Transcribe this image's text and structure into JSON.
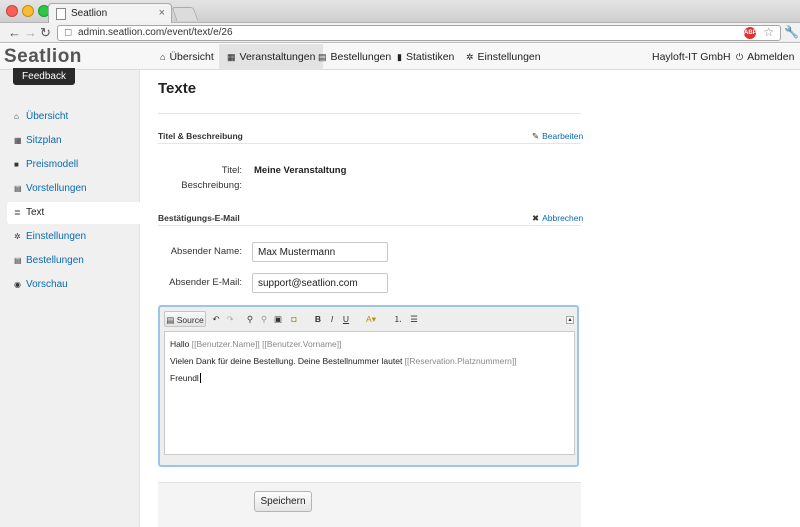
{
  "browser": {
    "tab_title": "Seatlion",
    "url": "admin.seatlion.com/event/text/e/26",
    "back_icon": "back-arrow-icon",
    "forward_icon": "forward-arrow-icon",
    "reload_icon": "reload-icon",
    "adblock_label": "ABP"
  },
  "app": {
    "logo_a": "Seat",
    "logo_b": "lion",
    "feedback_label": "Feedback",
    "nav": [
      {
        "label": "Übersicht",
        "icon": "home-icon"
      },
      {
        "label": "Veranstaltungen",
        "icon": "grid-icon"
      },
      {
        "label": "Bestellungen",
        "icon": "table-icon"
      },
      {
        "label": "Statistiken",
        "icon": "bar-chart-icon"
      },
      {
        "label": "Einstellungen",
        "icon": "gear-icon"
      }
    ],
    "company": "Hayloft-IT GmbH",
    "logout_label": "Abmelden"
  },
  "sidebar": {
    "items": [
      {
        "label": "Übersicht",
        "icon": "home-icon"
      },
      {
        "label": "Sitzplan",
        "icon": "grid-icon"
      },
      {
        "label": "Preismodell",
        "icon": "book-icon"
      },
      {
        "label": "Vorstellungen",
        "icon": "table-icon"
      },
      {
        "label": "Text",
        "icon": "text-align-icon"
      },
      {
        "label": "Einstellungen",
        "icon": "gear-icon"
      },
      {
        "label": "Bestellungen",
        "icon": "table-icon"
      },
      {
        "label": "Vorschau",
        "icon": "eye-icon"
      }
    ],
    "active_index": 4
  },
  "page": {
    "title": "Texte",
    "section1": {
      "title": "Titel & Beschreibung",
      "action": "Bearbeiten",
      "fields": [
        {
          "label": "Titel:",
          "value": "Meine Veranstaltung"
        },
        {
          "label": "Beschreibung:",
          "value": ""
        }
      ]
    },
    "section2": {
      "title": "Bestätigungs-E-Mail",
      "action": "Abbrechen",
      "sender_name_label": "Absender Name:",
      "sender_name_value": "Max Mustermann",
      "sender_email_label": "Absender E-Mail:",
      "sender_email_value": "support@seatlion.com"
    },
    "editor": {
      "source_label": "Source",
      "line1_text": "Hallo ",
      "line1_ph": "[[Benutzer.Name]] [[Benutzer.Vorname]]",
      "line2_text": "Vielen Dank für deine Bestellung. Deine Bestellnummer lautet ",
      "line2_ph": "[[Reservation.Platznummern]]",
      "line3_text": "Freundl"
    },
    "save_label": "Speichern"
  },
  "colors": {
    "link": "#0a6ab0",
    "editor_border": "#9cc5ea",
    "sidebar_bg": "#f0f0f0"
  }
}
